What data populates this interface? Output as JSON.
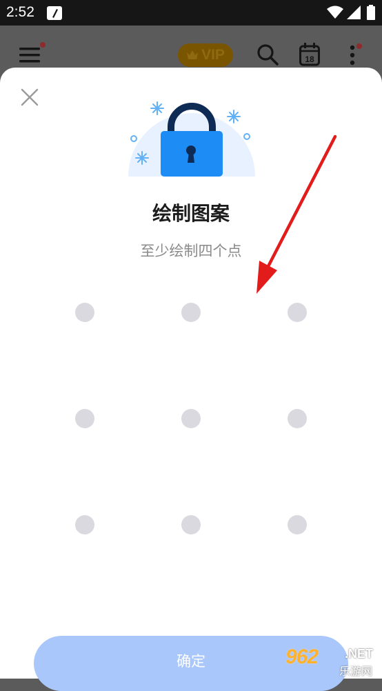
{
  "status_bar": {
    "time": "2:52",
    "icons": [
      "notification-icon",
      "wifi-icon",
      "signal-icon",
      "battery-icon"
    ]
  },
  "app_bar": {
    "vip_label": "VIP",
    "icons": [
      "menu-icon",
      "crown-icon",
      "search-icon",
      "calendar-icon",
      "more-icon"
    ],
    "calendar_day": "18"
  },
  "dialog": {
    "title": "绘制图案",
    "subtitle": "至少绘制四个点",
    "confirm_label": "确定",
    "icons": [
      "close-icon",
      "lock-icon"
    ],
    "pattern_dot_count": 9
  },
  "watermark": {
    "main": "962",
    "net": ".NET",
    "sub": "乐游网"
  },
  "colors": {
    "accent": "#1e8cf5",
    "lock_dark": "#0d2b55",
    "confirm_disabled": "#a9c7fb",
    "arrow": "#e21b1b",
    "dot": "#d9d9df"
  }
}
